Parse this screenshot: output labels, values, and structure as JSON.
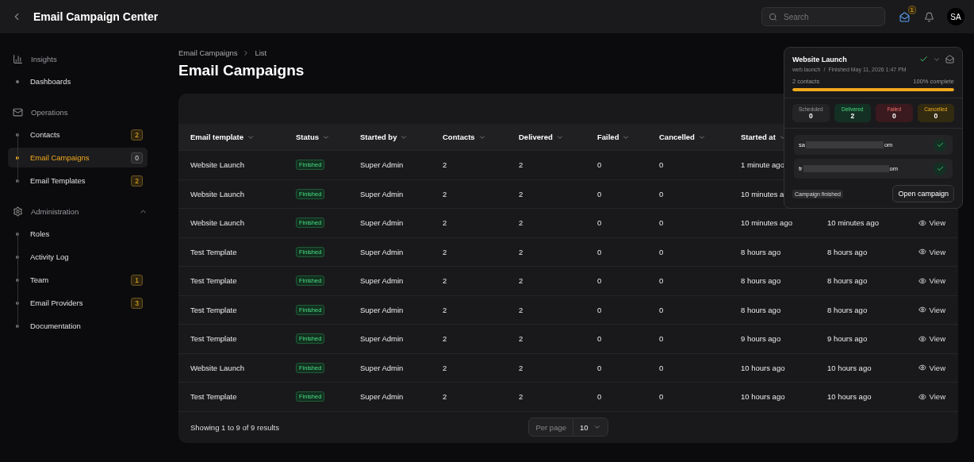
{
  "topbar": {
    "title": "Email Campaign Center",
    "search": {
      "placeholder": "Search"
    },
    "inbox_badge": "1",
    "avatar": "SA"
  },
  "sidebar": {
    "sections": [
      {
        "kind": "insights",
        "label": "Insights",
        "items": [
          {
            "label": "Dashboards",
            "selected": false
          }
        ]
      },
      {
        "kind": "operations",
        "label": "Operations",
        "items": [
          {
            "label": "Contacts",
            "badge": "2",
            "selected": false
          },
          {
            "label": "Email Campaigns",
            "badge": "0",
            "selected": true
          },
          {
            "label": "Email Templates",
            "badge": "2",
            "selected": false
          }
        ]
      },
      {
        "kind": "administration",
        "label": "Administration",
        "expanded": true,
        "items": [
          {
            "label": "Roles",
            "selected": false
          },
          {
            "label": "Activity Log",
            "selected": false
          },
          {
            "label": "Team",
            "badge": "1",
            "selected": false
          },
          {
            "label": "Email Providers",
            "badge": "3",
            "selected": false
          },
          {
            "label": "Documentation",
            "selected": false
          }
        ]
      }
    ]
  },
  "breadcrumb": [
    "Email Campaigns",
    "List"
  ],
  "page_title": "Email Campaigns",
  "table": {
    "columns": [
      "Email template",
      "Status",
      "Started by",
      "Contacts",
      "Delivered",
      "Failed",
      "Cancelled",
      "Started at"
    ],
    "rows": [
      {
        "cells": [
          "Website Launch",
          "Finished",
          "Super Admin",
          "2",
          "2",
          "0",
          "0",
          "1 minute ago"
        ]
      },
      {
        "cells": [
          "Website Launch",
          "Finished",
          "Super Admin",
          "2",
          "2",
          "0",
          "0",
          "10 minutes a"
        ]
      },
      {
        "cells": [
          "Website Launch",
          "Finished",
          "Super Admin",
          "2",
          "2",
          "0",
          "0",
          "10 minutes ago",
          "10 minutes ago"
        ],
        "action": "View"
      },
      {
        "cells": [
          "Test Template",
          "Finished",
          "Super Admin",
          "2",
          "2",
          "0",
          "0",
          "8 hours ago",
          "8 hours ago"
        ],
        "action": "View"
      },
      {
        "cells": [
          "Test Template",
          "Finished",
          "Super Admin",
          "2",
          "2",
          "0",
          "0",
          "8 hours ago",
          "8 hours ago"
        ],
        "action": "View"
      },
      {
        "cells": [
          "Test Template",
          "Finished",
          "Super Admin",
          "2",
          "2",
          "0",
          "0",
          "8 hours ago",
          "8 hours ago"
        ],
        "action": "View"
      },
      {
        "cells": [
          "Test Template",
          "Finished",
          "Super Admin",
          "2",
          "2",
          "0",
          "0",
          "9 hours ago",
          "9 hours ago"
        ],
        "action": "View"
      },
      {
        "cells": [
          "Website Launch",
          "Finished",
          "Super Admin",
          "2",
          "2",
          "0",
          "0",
          "10 hours ago",
          "10 hours ago"
        ],
        "action": "View"
      },
      {
        "cells": [
          "Test Template",
          "Finished",
          "Super Admin",
          "2",
          "2",
          "0",
          "0",
          "10 hours ago",
          "10 hours ago"
        ],
        "action": "View"
      }
    ],
    "summary": "Showing 1 to 9 of 9 results",
    "per_page_label": "Per page",
    "per_page": "10"
  },
  "popup": {
    "title": "Website Launch",
    "slug": "web.launch",
    "separator": "/",
    "finished": "Finished May 11, 2026 1:47 PM",
    "contacts": "2 contacts",
    "complete": "100% complete",
    "level": 1,
    "stats": [
      {
        "kind": "scheduled",
        "label": "Scheduled",
        "value": "0"
      },
      {
        "kind": "delivered",
        "label": "Delivered",
        "value": "2"
      },
      {
        "kind": "failed",
        "label": "Failed",
        "value": "0"
      },
      {
        "kind": "cancelled",
        "label": "Cancelled",
        "value": "0"
      }
    ],
    "recipients": [
      {
        "start": "sa",
        "end": "om",
        "delivered": true
      },
      {
        "start": "fr",
        "end": "om",
        "delivered": true
      }
    ],
    "tag": "Campaign finished",
    "button": "Open campaign"
  }
}
